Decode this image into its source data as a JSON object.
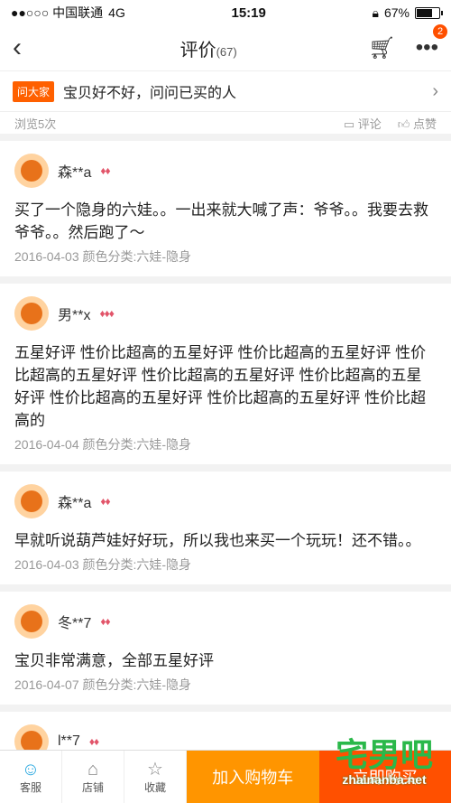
{
  "status": {
    "carrier": "●●○○○ 中国联通",
    "network": "4G",
    "time": "15:19",
    "battery": "67%",
    "battery_level": 0.67
  },
  "nav": {
    "title": "评价",
    "count": "(67)",
    "badge": "2"
  },
  "ask": {
    "tag": "问大家",
    "text": "宝贝好不好，问问已买的人"
  },
  "browse": {
    "text": "浏览5次",
    "comment": "评论",
    "like": "点赞"
  },
  "reviews": [
    {
      "user": "森**a",
      "level": "♦♦",
      "content": "买了一个隐身的六娃。。一出来就大喊了声：爷爷。。我要去救爷爷。。然后跑了～",
      "meta": "2016-04-03 颜色分类:六娃-隐身"
    },
    {
      "user": "男**x",
      "level": "♦♦♦",
      "content": "五星好评 性价比超高的五星好评 性价比超高的五星好评 性价比超高的五星好评 性价比超高的五星好评 性价比超高的五星好评 性价比超高的五星好评 性价比超高的五星好评 性价比超高的",
      "meta": "2016-04-04 颜色分类:六娃-隐身"
    },
    {
      "user": "森**a",
      "level": "♦♦",
      "content": "早就听说葫芦娃好好玩，所以我也来买一个玩玩！还不错。。",
      "meta": "2016-04-03 颜色分类:六娃-隐身"
    },
    {
      "user": "冬**7",
      "level": "♦♦",
      "content": "宝贝非常满意，全部五星好评",
      "meta": "2016-04-07 颜色分类:六娃-隐身"
    },
    {
      "user": "l**7",
      "level": "♦♦",
      "content": "",
      "meta": ""
    }
  ],
  "bottom": {
    "service": "客服",
    "shop": "店铺",
    "favorite": "收藏",
    "add_cart": "加入购物车",
    "buy": "立即购买"
  },
  "watermark": {
    "big": "宅男吧",
    "small": "zhainanba.net"
  }
}
